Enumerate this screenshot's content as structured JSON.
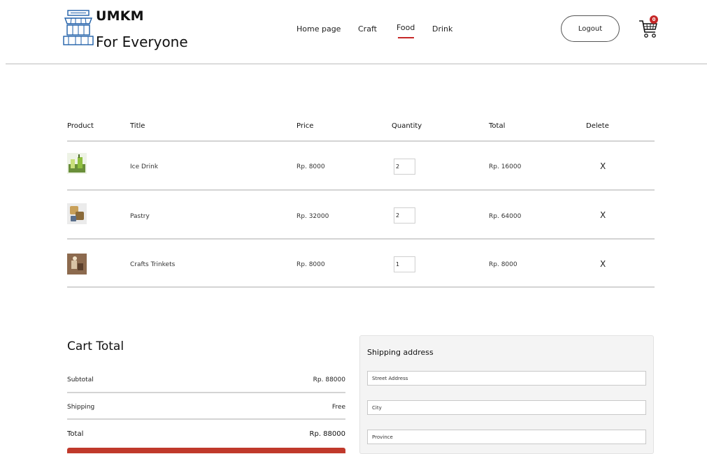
{
  "brand": {
    "line1": "UMKM",
    "line2": "For Everyone"
  },
  "nav": {
    "items": [
      {
        "label": "Home page"
      },
      {
        "label": "Craft"
      },
      {
        "label": "Food"
      },
      {
        "label": "Drink"
      }
    ],
    "active": "Food",
    "logout_label": "Logout",
    "cart_count": "0"
  },
  "table": {
    "headers": [
      "Product",
      "Title",
      "Price",
      "Quantity",
      "Total",
      "Delete"
    ],
    "rows": [
      {
        "thumb": "drink-thumbnail",
        "title": "Ice Drink",
        "price": "Rp. 8000",
        "quantity": "2",
        "total": "Rp. 16000",
        "delete": "X"
      },
      {
        "thumb": "pastry-thumbnail",
        "title": "Pastry",
        "price": "Rp. 32000",
        "quantity": "2",
        "total": "Rp. 64000",
        "delete": "X"
      },
      {
        "thumb": "crafts-thumbnail",
        "title": "Crafts Trinkets",
        "price": "Rp. 8000",
        "quantity": "1",
        "total": "Rp. 8000",
        "delete": "X"
      }
    ]
  },
  "cart_total": {
    "title": "Cart Total",
    "subtotal_label": "Subtotal",
    "subtotal_value": "Rp. 88000",
    "shipping_label": "Shipping",
    "shipping_value": "Free",
    "total_label": "Total",
    "total_value": "Rp. 88000"
  },
  "shipping": {
    "title": "Shipping address",
    "street_placeholder": "Street Address",
    "city_placeholder": "City",
    "province_placeholder": "Province"
  },
  "colors": {
    "accent": "#c62828",
    "checkout": "#c0392b"
  },
  "icons": {
    "logo": "storefront-icon",
    "cart": "shopping-cart-icon",
    "delete": "close-icon"
  }
}
